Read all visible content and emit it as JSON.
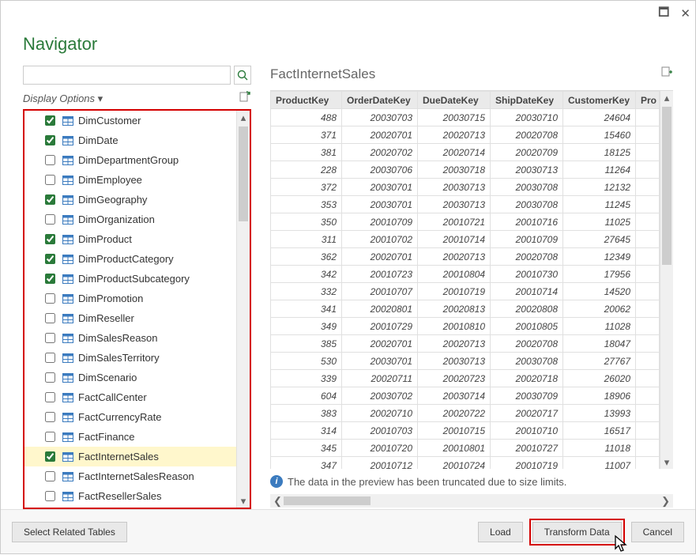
{
  "window": {
    "title": "Navigator"
  },
  "search": {
    "placeholder": ""
  },
  "display_options_label": "Display Options",
  "tree": {
    "items": [
      {
        "label": "DimCustomer",
        "checked": true
      },
      {
        "label": "DimDate",
        "checked": true
      },
      {
        "label": "DimDepartmentGroup",
        "checked": false
      },
      {
        "label": "DimEmployee",
        "checked": false
      },
      {
        "label": "DimGeography",
        "checked": true
      },
      {
        "label": "DimOrganization",
        "checked": false
      },
      {
        "label": "DimProduct",
        "checked": true
      },
      {
        "label": "DimProductCategory",
        "checked": true
      },
      {
        "label": "DimProductSubcategory",
        "checked": true
      },
      {
        "label": "DimPromotion",
        "checked": false
      },
      {
        "label": "DimReseller",
        "checked": false
      },
      {
        "label": "DimSalesReason",
        "checked": false
      },
      {
        "label": "DimSalesTerritory",
        "checked": false
      },
      {
        "label": "DimScenario",
        "checked": false
      },
      {
        "label": "FactCallCenter",
        "checked": false
      },
      {
        "label": "FactCurrencyRate",
        "checked": false
      },
      {
        "label": "FactFinance",
        "checked": false
      },
      {
        "label": "FactInternetSales",
        "checked": true,
        "selected": true
      },
      {
        "label": "FactInternetSalesReason",
        "checked": false
      },
      {
        "label": "FactResellerSales",
        "checked": false
      }
    ]
  },
  "preview": {
    "title": "FactInternetSales",
    "columns": [
      "ProductKey",
      "OrderDateKey",
      "DueDateKey",
      "ShipDateKey",
      "CustomerKey",
      "Pro"
    ],
    "rows": [
      [
        "488",
        "20030703",
        "20030715",
        "20030710",
        "24604"
      ],
      [
        "371",
        "20020701",
        "20020713",
        "20020708",
        "15460"
      ],
      [
        "381",
        "20020702",
        "20020714",
        "20020709",
        "18125"
      ],
      [
        "228",
        "20030706",
        "20030718",
        "20030713",
        "11264"
      ],
      [
        "372",
        "20030701",
        "20030713",
        "20030708",
        "12132"
      ],
      [
        "353",
        "20030701",
        "20030713",
        "20030708",
        "11245"
      ],
      [
        "350",
        "20010709",
        "20010721",
        "20010716",
        "11025"
      ],
      [
        "311",
        "20010702",
        "20010714",
        "20010709",
        "27645"
      ],
      [
        "362",
        "20020701",
        "20020713",
        "20020708",
        "12349"
      ],
      [
        "342",
        "20010723",
        "20010804",
        "20010730",
        "17956"
      ],
      [
        "332",
        "20010707",
        "20010719",
        "20010714",
        "14520"
      ],
      [
        "341",
        "20020801",
        "20020813",
        "20020808",
        "20062"
      ],
      [
        "349",
        "20010729",
        "20010810",
        "20010805",
        "11028"
      ],
      [
        "385",
        "20020701",
        "20020713",
        "20020708",
        "18047"
      ],
      [
        "530",
        "20030701",
        "20030713",
        "20030708",
        "27767"
      ],
      [
        "339",
        "20020711",
        "20020723",
        "20020718",
        "26020"
      ],
      [
        "604",
        "20030702",
        "20030714",
        "20030709",
        "18906"
      ],
      [
        "383",
        "20020710",
        "20020722",
        "20020717",
        "13993"
      ],
      [
        "314",
        "20010703",
        "20010715",
        "20010710",
        "16517"
      ],
      [
        "345",
        "20010720",
        "20010801",
        "20010727",
        "11018"
      ],
      [
        "347",
        "20010712",
        "20010724",
        "20010719",
        "11007"
      ]
    ],
    "truncated_msg": "The data in the preview has been truncated due to size limits."
  },
  "footer": {
    "select_related": "Select Related Tables",
    "load": "Load",
    "transform": "Transform Data",
    "cancel": "Cancel"
  }
}
